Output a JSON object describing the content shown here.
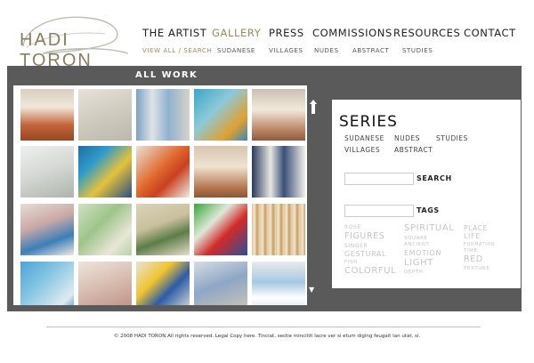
{
  "logo": {
    "text": "HADI TORON"
  },
  "nav": {
    "items": [
      "THE ARTIST",
      "GALLERY",
      "PRESS",
      "COMMISSIONS",
      "RESOURCES",
      "CONTACT"
    ],
    "active_color": "#9a8a5a"
  },
  "subnav": {
    "items": [
      "VIEW ALL / SEARCH",
      "SUDANESE",
      "VILLAGES",
      "NUDES",
      "ABSTRACT",
      "STUDIES"
    ]
  },
  "gallery": {
    "title": "ALL WORK"
  },
  "series": {
    "title": "SERIES",
    "links": [
      "SUDANESE",
      "NUDES",
      "STUDIES",
      "VILLAGES",
      "ABSTRACT"
    ]
  },
  "search": {
    "label": "SEARCH"
  },
  "tags": {
    "label": "TAGS",
    "items": [
      "ROSE",
      "FIGURES",
      "SINGER",
      "GESTURAL",
      "FISH",
      "COLORFUL",
      "SPIRITUAL",
      "SQUARE",
      "ANCIENT",
      "EMOTION",
      "LIGHT",
      "DEPTH",
      "PLACE",
      "LIFE",
      "FORMATION",
      "TIME",
      "RED",
      "TEXTURE"
    ]
  },
  "footer": {
    "text": "© 2008 HADI TORON All rights reserved. Legal Copy here. Tinciat, sectie minciilit lacre ver si etum diging feugait lan utat, si."
  }
}
